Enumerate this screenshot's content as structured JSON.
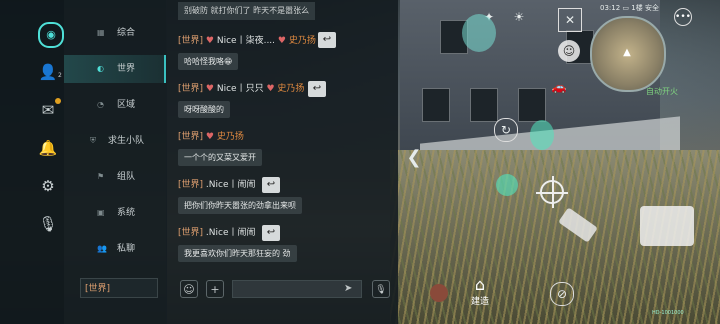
{
  "nav_rail": {
    "items": [
      {
        "icon": "chat-bubble-icon"
      },
      {
        "icon": "friends-icon",
        "badge": "2"
      },
      {
        "icon": "mail-icon"
      },
      {
        "icon": "bell-icon"
      },
      {
        "icon": "gear-icon"
      },
      {
        "icon": "microphone-icon"
      }
    ]
  },
  "channels": {
    "items": [
      {
        "label": "综合",
        "icon": "grid-icon"
      },
      {
        "label": "世界",
        "icon": "globe-icon",
        "active": true
      },
      {
        "label": "区域",
        "icon": "region-icon"
      },
      {
        "label": "求生小队",
        "icon": "shield-icon"
      },
      {
        "label": "组队",
        "icon": "flag-icon"
      },
      {
        "label": "系统",
        "icon": "system-icon"
      },
      {
        "label": "私聊",
        "icon": "person-icon"
      }
    ],
    "current_channel_input": "[世界]"
  },
  "chat": {
    "top_message": "别破防 就打你们了 昨天不是嚣张么",
    "messages": [
      {
        "channel": "[世界]",
        "name": "Nice丨柒夜....",
        "tag": "史乃扬",
        "text": "哈哈怪我咯😁"
      },
      {
        "channel": "[世界]",
        "name": "Nice丨只只",
        "tag": "史乃扬",
        "text": "呀呀酸酸的"
      },
      {
        "channel": "[世界]",
        "name": "史乃扬",
        "tag": "",
        "text": "一个个的又菜又爱开"
      },
      {
        "channel": "[世界]",
        "name": ".Nice丨闹闹",
        "tag": "",
        "text": "把你们你昨天嚣张的劲拿出来呗"
      },
      {
        "channel": "[世界]",
        "name": ".Nice丨闹闹",
        "tag": "",
        "text": "我更喜欢你们昨天那狂妄的 劲"
      }
    ],
    "reply_icon": "reply-arrow-icon",
    "emoji_icon": "emoji-icon",
    "add_icon": "plus-icon",
    "send_icon": "send-icon",
    "voice_icon": "voice-input-icon"
  },
  "hud": {
    "time": "03:12",
    "weather": "1楼 安全",
    "auto_fire": "自动开火",
    "build_label": "建造",
    "version": "HD-1001000"
  },
  "colors": {
    "accent": "#3ac0c0",
    "channel_tag": "#e0a070",
    "name_tag": "#e08a40",
    "auto_fire": "#7fd37f"
  }
}
